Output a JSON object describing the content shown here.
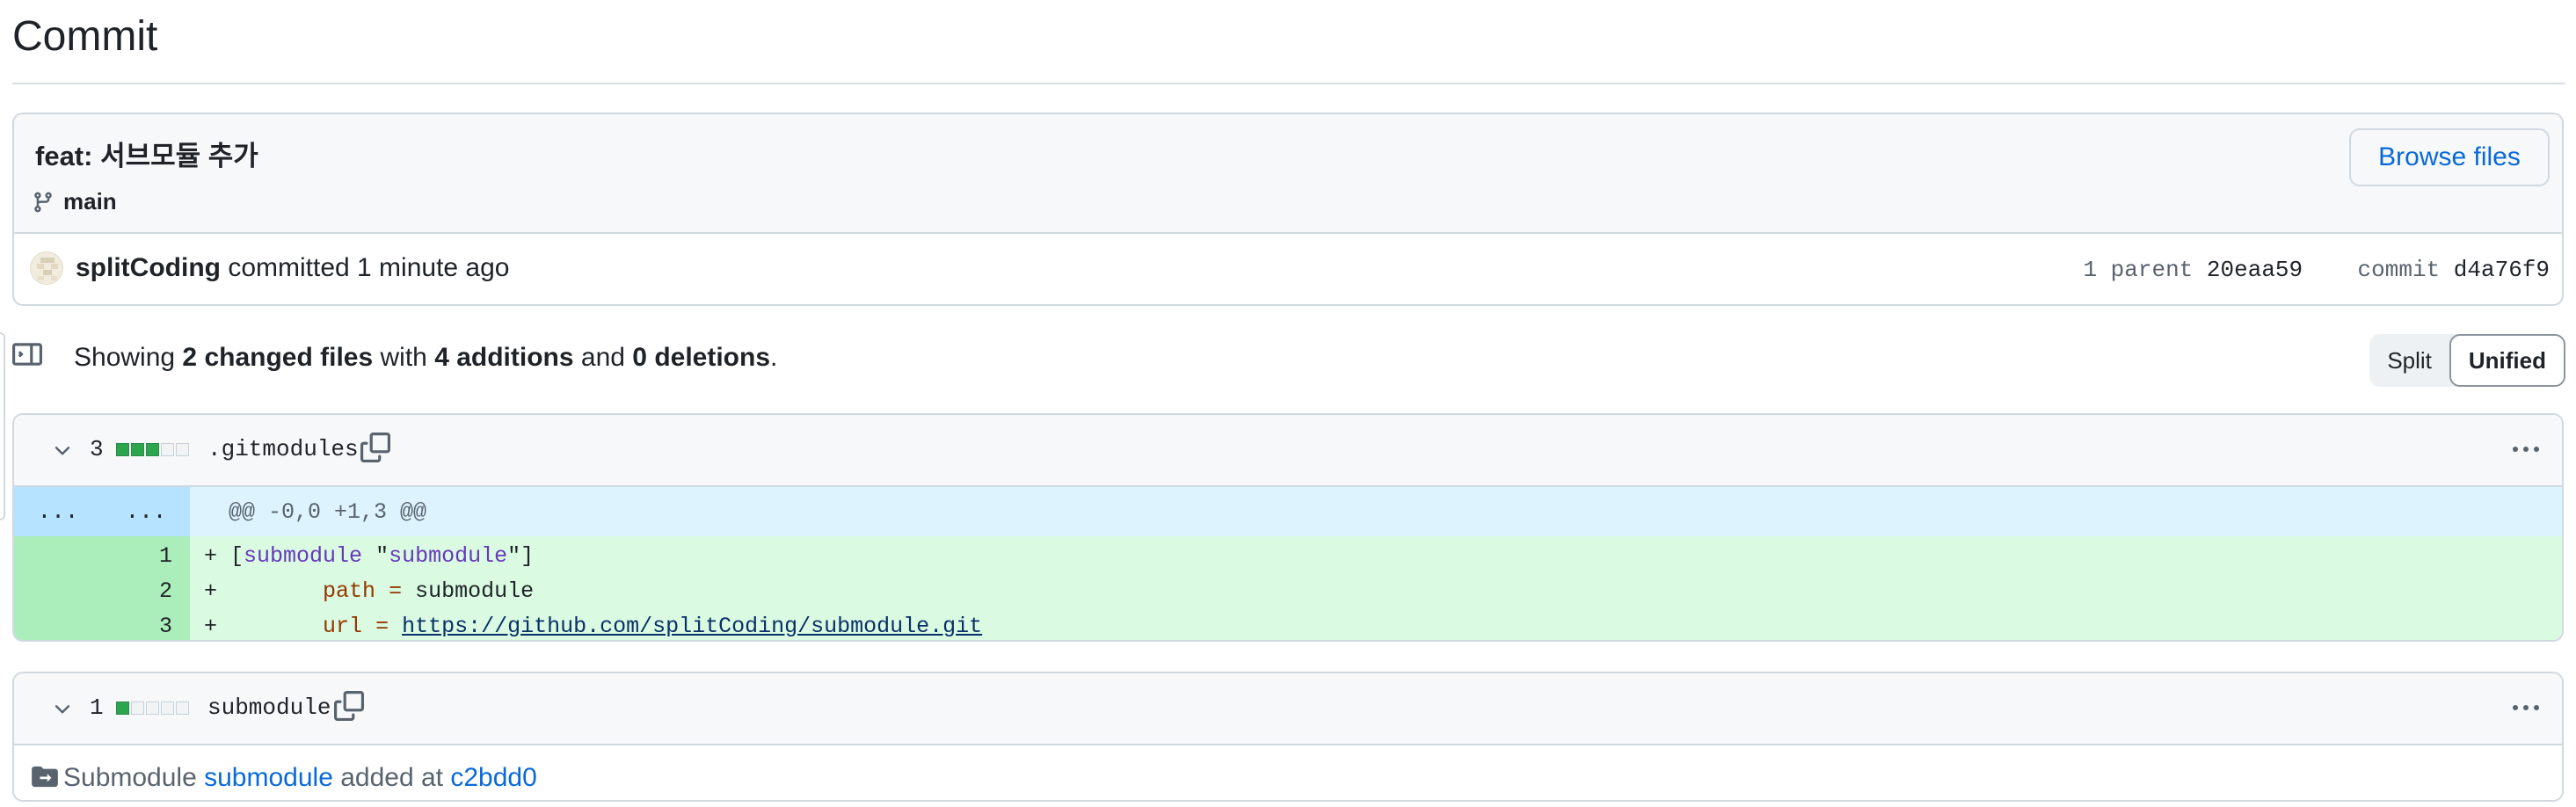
{
  "page": {
    "title": "Commit"
  },
  "commit": {
    "message": "feat: 서브모듈 추가",
    "branch": "main",
    "browse_label": "Browse files",
    "author": "splitCoding",
    "committed_text": "committed 1 minute ago",
    "parent_label": "1 parent",
    "parent_sha": "20eaa59",
    "commit_label": "commit",
    "commit_sha": "d4a76f9"
  },
  "summary": {
    "prefix": "Showing ",
    "files": "2 changed files",
    "with": " with ",
    "additions": "4 additions",
    "and": " and ",
    "deletions": "0 deletions",
    "suffix": "."
  },
  "view_toggle": {
    "split": "Split",
    "unified": "Unified",
    "selected": "Unified"
  },
  "files": [
    {
      "count": "3",
      "name": ".gitmodules",
      "blocks": [
        "add",
        "add",
        "add",
        "neutral",
        "neutral"
      ],
      "hunk": {
        "left": "...",
        "right": "...",
        "header": "@@ -0,0 +1,3 @@"
      },
      "lines": [
        {
          "num": "1",
          "sign": "+",
          "parts": [
            " [",
            "submodule",
            " \"",
            "submodule",
            "\"]"
          ]
        },
        {
          "num": "2",
          "sign": "+",
          "indent": "        ",
          "key": "path",
          "eq": " = ",
          "value": "submodule"
        },
        {
          "num": "3",
          "sign": "+",
          "indent": "        ",
          "key": "url",
          "eq": " = ",
          "value": "https://github.com/splitCoding/submodule.git"
        }
      ]
    },
    {
      "count": "1",
      "name": "submodule",
      "blocks": [
        "add",
        "neutral",
        "neutral",
        "neutral",
        "neutral"
      ],
      "sub_prefix": "Submodule ",
      "sub_name": "submodule",
      "sub_mid": " added at ",
      "sub_sha": "c2bdd0"
    }
  ],
  "colors": {
    "accent": "#0969da",
    "add_bg": "#dafbe1",
    "add_gutter": "#aceebb",
    "hunk_bg": "#ddf4ff",
    "hunk_num_bg": "#b6e3ff",
    "add_block": "#2da44e"
  },
  "icons": [
    "git-branch-icon",
    "sidebar-toggle-icon",
    "chevron-down-icon",
    "copy-icon",
    "kebab-horizontal-icon",
    "file-submodule-icon"
  ]
}
